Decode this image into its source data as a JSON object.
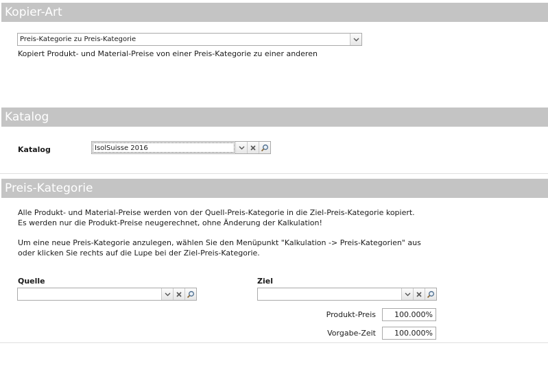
{
  "kopier_art": {
    "header": "Kopier-Art",
    "select_value": "Preis-Kategorie zu Preis-Kategorie",
    "description": "Kopiert Produkt- und Material-Preise von einer Preis-Kategorie zu einer anderen"
  },
  "katalog": {
    "header": "Katalog",
    "label": "Katalog",
    "value": "IsolSuisse 2016"
  },
  "preis_kategorie": {
    "header": "Preis-Kategorie",
    "info_line1": "Alle Produkt- und Material-Preise werden von der Quell-Preis-Kategorie in die Ziel-Preis-Kategorie kopiert.",
    "info_line2": "Es werden nur die Produkt-Preise neugerechnet, ohne Änderung der Kalkulation!",
    "info_line3": "Um eine neue Preis-Kategorie anzulegen, wählen Sie den Menüpunkt \"Kalkulation -> Preis-Kategorien\" aus",
    "info_line4": "oder klicken Sie rechts auf die Lupe bei der Ziel-Preis-Kategorie.",
    "quelle_label": "Quelle",
    "quelle_value": "",
    "ziel_label": "Ziel",
    "ziel_value": "",
    "produkt_preis_label": "Produkt-Preis",
    "produkt_preis_value": "100.000%",
    "vorgabe_zeit_label": "Vorgabe-Zeit",
    "vorgabe_zeit_value": "100.000%"
  },
  "icons": {
    "dropdown": "chevron-down-icon",
    "clear": "clear-x-icon",
    "search": "magnifier-icon"
  }
}
